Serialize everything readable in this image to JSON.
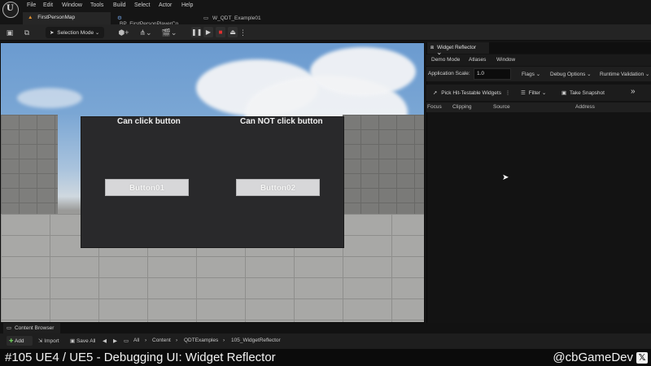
{
  "menubar": {
    "items": [
      "File",
      "Edit",
      "Window",
      "Tools",
      "Build",
      "Select",
      "Actor",
      "Help"
    ]
  },
  "tabs": [
    {
      "label": "FirstPersonMap",
      "active": true
    },
    {
      "label": "BP_FirstPersonPlayerCo...",
      "active": false
    },
    {
      "label": "W_QDT_Example01",
      "active": false
    }
  ],
  "toolbar": {
    "selection_mode": "Selection Mode"
  },
  "viewport": {
    "widget": {
      "left_label": "Can click button",
      "right_label": "Can NOT click button",
      "button1": "Button01",
      "button2": "Button02"
    }
  },
  "reflector": {
    "tab_label": "Widget Reflector",
    "menu": [
      "Demo Mode",
      "Atlases",
      "Window"
    ],
    "scale_label": "Application Scale:",
    "scale_value": "1.0",
    "flags": "Flags",
    "debug_options": "Debug Options",
    "runtime_validation": "Runtime Validation",
    "pick_widgets": "Pick Hit-Testable Widgets",
    "filter": "Filter",
    "snapshot": "Take Snapshot",
    "columns": [
      "Focus",
      "Clipping",
      "Source",
      "Address"
    ]
  },
  "content_browser": {
    "tab_label": "Content Browser",
    "add": "Add",
    "import": "Import",
    "save_all": "Save All",
    "path": [
      "All",
      "Content",
      "QDTExamples",
      "105_WidgetReflector"
    ]
  },
  "caption": {
    "title": "#105 UE4 / UE5 - Debugging UI: Widget Reflector",
    "handle": "@cbGameDev"
  }
}
